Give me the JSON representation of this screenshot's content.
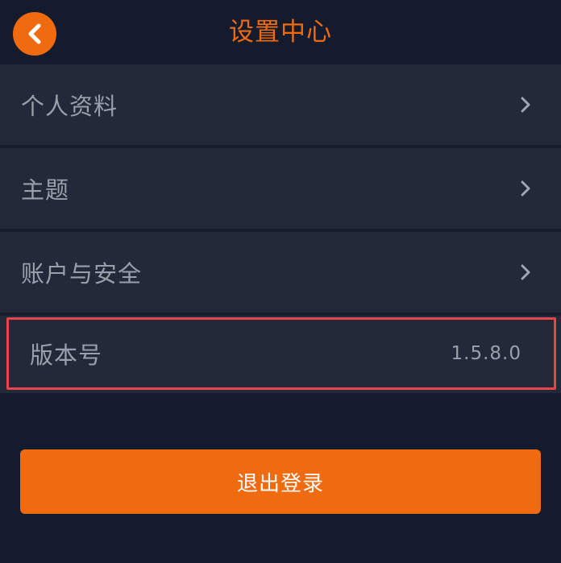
{
  "header": {
    "title": "设置中心",
    "back_icon": "chevron-left-icon"
  },
  "settings": {
    "items": [
      {
        "label": "个人资料",
        "icon": "chevron-right-icon"
      },
      {
        "label": "主题",
        "icon": "chevron-right-icon"
      },
      {
        "label": "账户与安全",
        "icon": "chevron-right-icon"
      }
    ],
    "version": {
      "label": "版本号",
      "value": "1.5.8.0"
    }
  },
  "actions": {
    "logout_label": "退出登录"
  },
  "colors": {
    "accent": "#f06a10",
    "background": "#141b2c",
    "row_background": "#222a3a",
    "text_muted": "#9aa0aa",
    "highlight_border": "#e8444c"
  }
}
